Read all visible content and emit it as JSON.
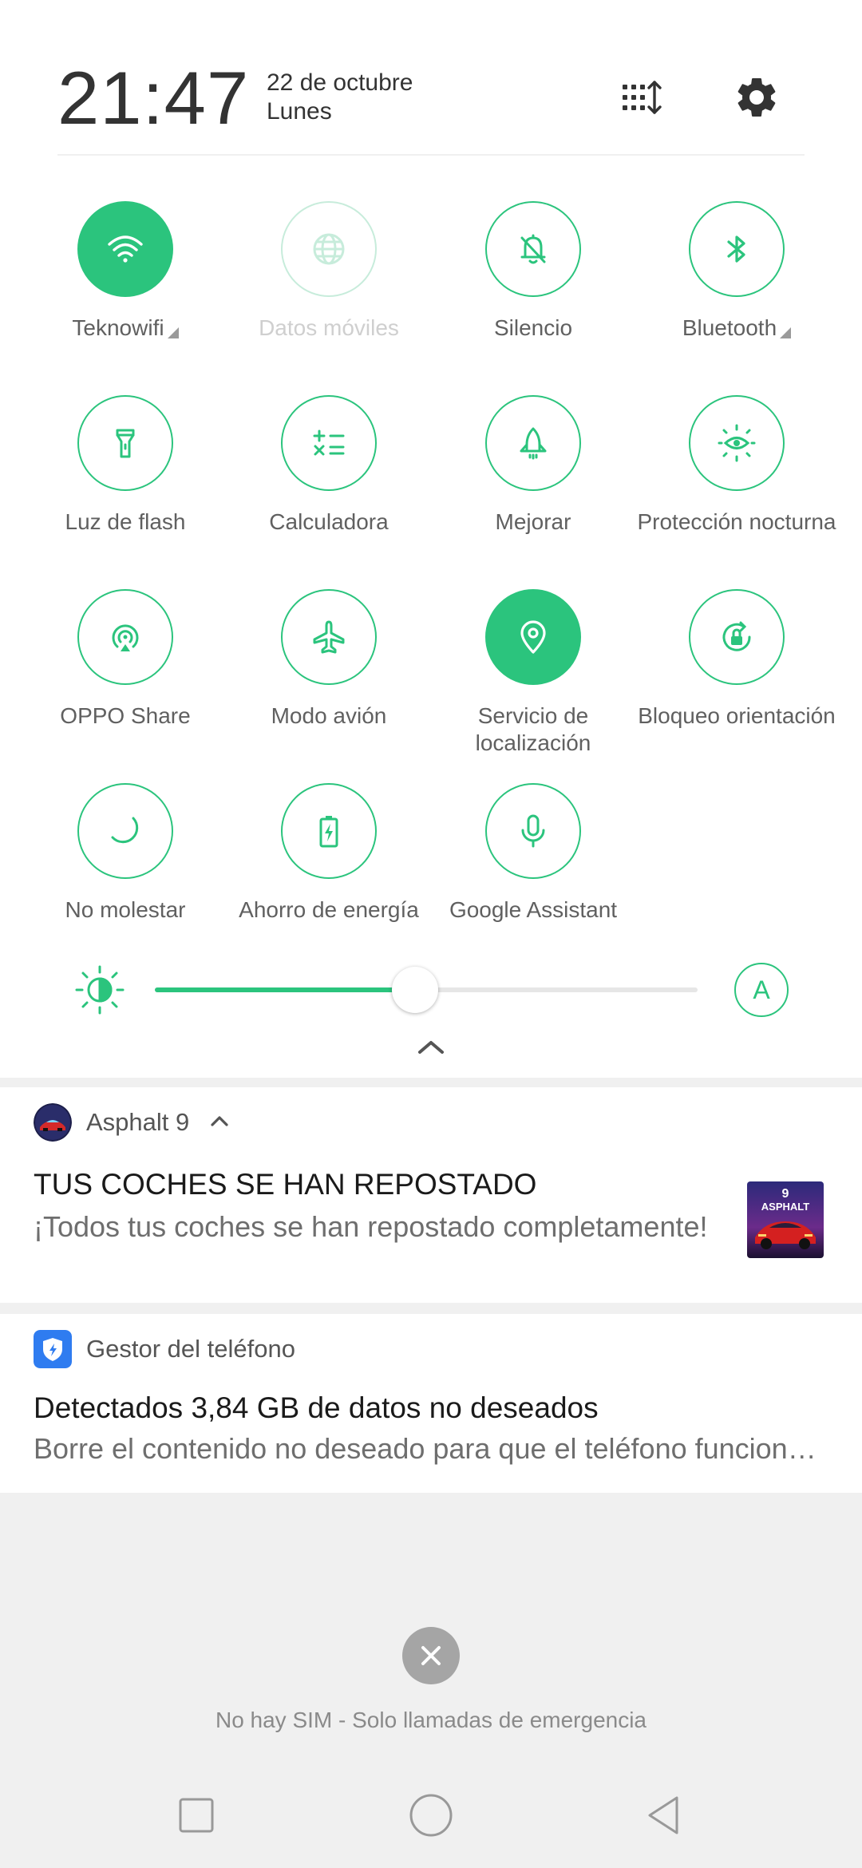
{
  "status": {
    "time": "21:47",
    "date": "22 de octubre",
    "day": "Lunes"
  },
  "header_icons": [
    "edit-tiles-icon",
    "settings-gear-icon"
  ],
  "tiles": [
    {
      "label": "Teknowifi",
      "icon": "wifi-icon",
      "state": "active",
      "has_menu": true
    },
    {
      "label": "Datos móviles",
      "icon": "globe-icon",
      "state": "disabled",
      "has_menu": false
    },
    {
      "label": "Silencio",
      "icon": "bell-off-icon",
      "state": "inactive",
      "has_menu": false
    },
    {
      "label": "Bluetooth",
      "icon": "bluetooth-icon",
      "state": "inactive",
      "has_menu": true
    },
    {
      "label": "Luz de flash",
      "icon": "flashlight-icon",
      "state": "inactive"
    },
    {
      "label": "Calculadora",
      "icon": "calculator-icon",
      "state": "inactive"
    },
    {
      "label": "Mejorar",
      "icon": "rocket-icon",
      "state": "inactive"
    },
    {
      "label": "Protección nocturna",
      "icon": "eye-comfort-icon",
      "state": "inactive"
    },
    {
      "label": "OPPO Share",
      "icon": "share-target-icon",
      "state": "inactive"
    },
    {
      "label": "Modo avión",
      "icon": "airplane-icon",
      "state": "inactive"
    },
    {
      "label": "Servicio de localización",
      "icon": "location-pin-icon",
      "state": "active"
    },
    {
      "label": "Bloqueo orientación",
      "icon": "rotation-lock-icon",
      "state": "inactive"
    },
    {
      "label": "No molestar",
      "icon": "moon-icon",
      "state": "inactive"
    },
    {
      "label": "Ahorro de energía",
      "icon": "battery-saver-icon",
      "state": "inactive"
    },
    {
      "label": "Google Assistant",
      "icon": "microphone-icon",
      "state": "inactive"
    }
  ],
  "brightness": {
    "level": 0.48,
    "auto_label": "A"
  },
  "notifications": [
    {
      "app": "Asphalt 9",
      "title": "TUS COCHES SE HAN REPOSTADO",
      "text": "¡Todos tus coches se han repostado completamente!",
      "thumb_text": "ASPHALT",
      "thumb_number": "9"
    },
    {
      "app": "Gestor del teléfono",
      "title": "Detectados 3,84 GB de datos no deseados",
      "text": "Borre el contenido no deseado para que el teléfono funcione mejor"
    }
  ],
  "lock": {
    "sim_status": "No hay SIM - Solo llamadas de emergencia"
  },
  "colors": {
    "accent": "#2bc47d",
    "accent_disabled": "#c7ecdb",
    "background": "#f0f0f0",
    "panel": "#ffffff"
  }
}
